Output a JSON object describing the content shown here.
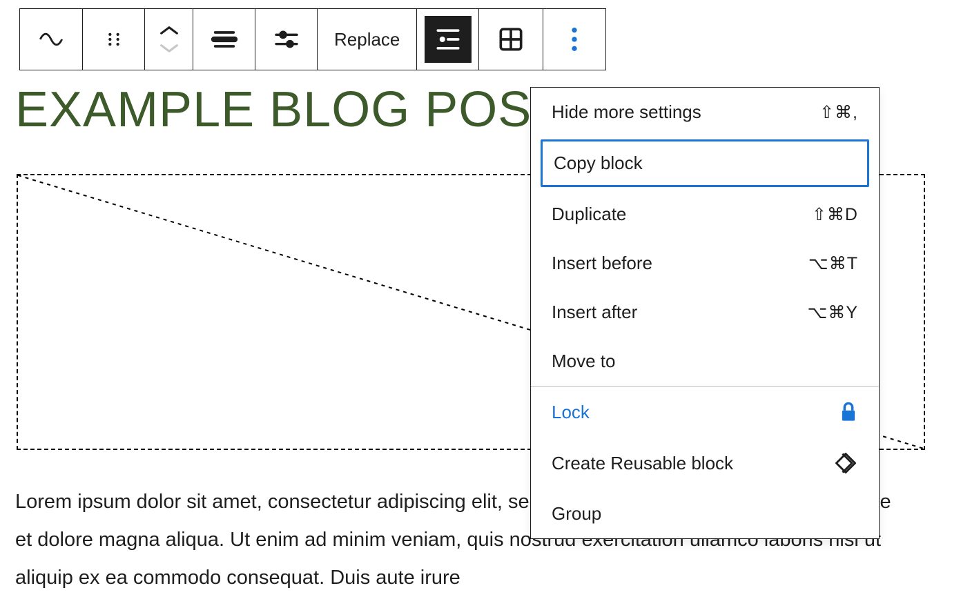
{
  "toolbar": {
    "replace_label": "Replace"
  },
  "heading": "EXAMPLE BLOG POST",
  "paragraph": "Lorem ipsum dolor sit amet, consectetur adipiscing elit, sed do eiusmod tempor incididunt ut labore et dolore magna aliqua. Ut enim ad minim veniam, quis nostrud exercitation ullamco laboris nisi ut aliquip ex ea commodo consequat. Duis aute irure",
  "menu": {
    "items": [
      {
        "label": "Hide more settings",
        "shortcut": "⇧⌘,"
      },
      {
        "label": "Copy block",
        "shortcut": ""
      },
      {
        "label": "Duplicate",
        "shortcut": "⇧⌘D"
      },
      {
        "label": "Insert before",
        "shortcut": "⌥⌘T"
      },
      {
        "label": "Insert after",
        "shortcut": "⌥⌘Y"
      },
      {
        "label": "Move to",
        "shortcut": ""
      },
      {
        "label": "Lock",
        "shortcut": ""
      },
      {
        "label": "Create Reusable block",
        "shortcut": ""
      },
      {
        "label": "Group",
        "shortcut": ""
      }
    ]
  }
}
